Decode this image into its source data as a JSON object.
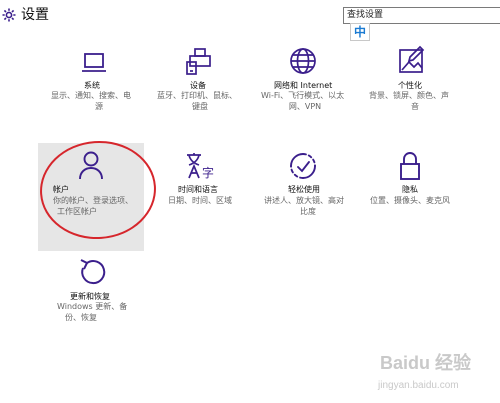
{
  "window": {
    "title": "设置"
  },
  "search": {
    "value": "查找设置"
  },
  "ime": {
    "label": "中"
  },
  "colors": {
    "accent": "#3b1f8c",
    "annotation": "#d6262c",
    "selected_bg": "#e6e6e6"
  },
  "tiles": [
    {
      "icon": "laptop-icon",
      "title": "系统",
      "desc": [
        "显示、通知、搜索、电",
        "源"
      ]
    },
    {
      "icon": "devices-icon",
      "title": "设备",
      "desc": [
        "蓝牙、打印机、鼠标、",
        "键盘"
      ]
    },
    {
      "icon": "globe-icon",
      "title": "网络和 Internet",
      "desc": [
        "Wi-Fi、飞行模式、以太",
        "网、VPN"
      ]
    },
    {
      "icon": "personalization-icon",
      "title": "个性化",
      "desc": [
        "背景、锁屏、颜色、声",
        "音"
      ]
    },
    {
      "icon": "person-icon",
      "title": "帐户",
      "desc": [
        "你的帐户、登录选项、",
        "工作区帐户"
      ]
    },
    {
      "icon": "language-icon",
      "title": "时间和语言",
      "desc": [
        "日期、时间、区域"
      ]
    },
    {
      "icon": "accessibility-icon",
      "title": "轻松使用",
      "desc": [
        "讲述人、放大镜、高对",
        "比度"
      ]
    },
    {
      "icon": "lock-icon",
      "title": "隐私",
      "desc": [
        "位置、摄像头、麦克风"
      ]
    },
    {
      "icon": "refresh-icon",
      "title": "更新和恢复",
      "desc": [
        "Windows 更新、备",
        "份、恢复"
      ]
    }
  ],
  "watermark": {
    "main": "Baidu 经验",
    "sub": "jingyan.baidu.com"
  }
}
